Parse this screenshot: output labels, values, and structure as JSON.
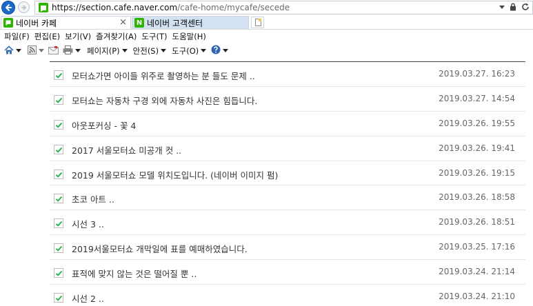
{
  "address_bar": {
    "url_host": "https://section.cafe.naver.com",
    "url_path": "/cafe-home/mycafe/secede"
  },
  "tabs": [
    {
      "label": "네이버 카페",
      "active": true,
      "close_label": "×"
    },
    {
      "label": "네이버 고객센터",
      "active": false,
      "icon_letter": "N"
    }
  ],
  "menu": [
    "파일(F)",
    "편집(E)",
    "보기(V)",
    "즐겨찾기(A)",
    "도구(T)",
    "도움말(H)"
  ],
  "command_bar": {
    "page_label": "페이지(P)",
    "safety_label": "안전(S)",
    "tools_label": "도구(O)"
  },
  "posts": [
    {
      "title": "모터쇼가면 아이들 위주로 촬영하는 분 들도 문제 ..",
      "date": "2019.03.27. 16:23",
      "checked": true
    },
    {
      "title": "모터쇼는 자동차 구경 외에 자동차 사진은 힘듭니다.",
      "date": "2019.03.27. 14:54",
      "checked": true
    },
    {
      "title": "아웃포커싱 - 꽃 4",
      "date": "2019.03.26. 19:55",
      "checked": true
    },
    {
      "title": "2017 서울모터쇼 미공개 컷 ..",
      "date": "2019.03.26. 19:41",
      "checked": true
    },
    {
      "title": "2019 서울모터쇼 모델 위치도입니다. (네이버 이미지 펌)",
      "date": "2019.03.26. 19:15",
      "checked": true
    },
    {
      "title": "초코 아트 ..",
      "date": "2019.03.26. 18:58",
      "checked": true
    },
    {
      "title": "시선 3 ..",
      "date": "2019.03.26. 18:51",
      "checked": true
    },
    {
      "title": "2019서울모터쇼 개막일에 표를 예매하였습니다.",
      "date": "2019.03.25. 17:16",
      "checked": true
    },
    {
      "title": "표적에 맞지 않는 것은 떨어질 뿐 ..",
      "date": "2019.03.24. 21:14",
      "checked": true
    },
    {
      "title": "시선 2 ..",
      "date": "2019.03.24. 21:10",
      "checked": true
    }
  ],
  "colors": {
    "accent": "#1b6ac9",
    "check_green": "#27b44a",
    "naver_green": "#2db400"
  }
}
